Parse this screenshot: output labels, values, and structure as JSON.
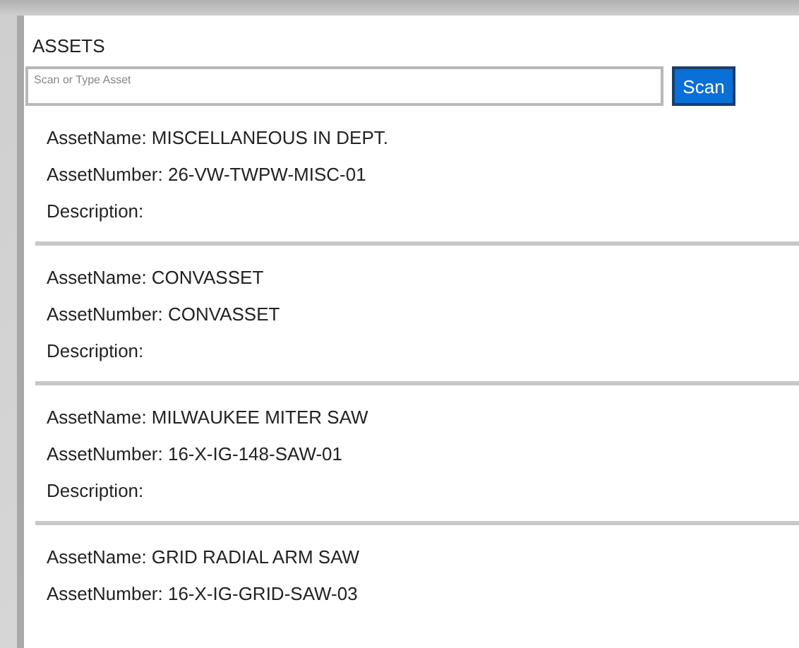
{
  "title": "ASSETS",
  "search": {
    "placeholder": "Scan or Type Asset"
  },
  "scan_button": "Scan",
  "assets": [
    {
      "lines": [
        "AssetName: MISCELLANEOUS IN DEPT.",
        "AssetNumber: 26-VW-TWPW-MISC-01",
        "Description:"
      ]
    },
    {
      "lines": [
        "AssetName: CONVASSET",
        "AssetNumber: CONVASSET",
        "Description:"
      ]
    },
    {
      "lines": [
        "AssetName: MILWAUKEE MITER SAW",
        "AssetNumber: 16-X-IG-148-SAW-01",
        "Description:"
      ]
    },
    {
      "lines": [
        "AssetName: GRID RADIAL ARM SAW",
        "AssetNumber: 16-X-IG-GRID-SAW-03"
      ]
    }
  ]
}
